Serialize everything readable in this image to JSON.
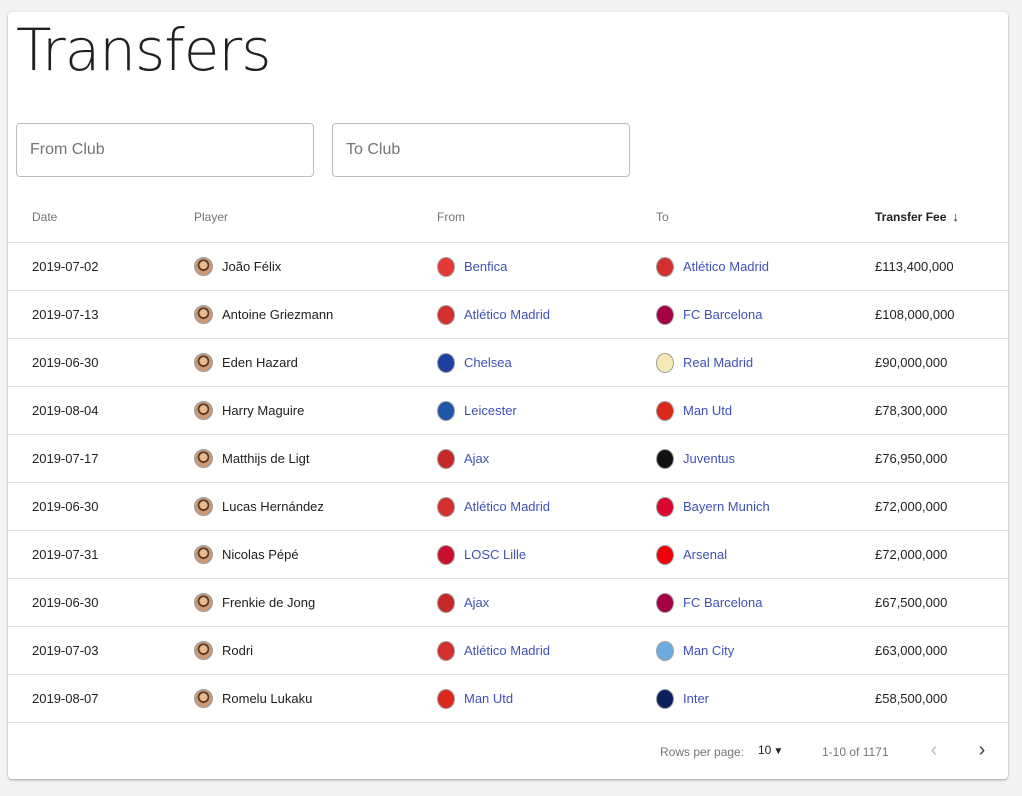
{
  "page": {
    "title": "Transfers"
  },
  "filters": {
    "from_placeholder": "From Club",
    "to_placeholder": "To Club"
  },
  "table": {
    "headers": {
      "date": "Date",
      "player": "Player",
      "from": "From",
      "to": "To",
      "fee": "Transfer Fee"
    },
    "sort_icon": "arrow-down-icon",
    "rows": [
      {
        "date": "2019-07-02",
        "player": "João Félix",
        "from": "Benfica",
        "to": "Atlético Madrid",
        "fee": "£113,400,000"
      },
      {
        "date": "2019-07-13",
        "player": "Antoine Griezmann",
        "from": "Atlético Madrid",
        "to": "FC Barcelona",
        "fee": "£108,000,000"
      },
      {
        "date": "2019-06-30",
        "player": "Eden Hazard",
        "from": "Chelsea",
        "to": "Real Madrid",
        "fee": "£90,000,000"
      },
      {
        "date": "2019-08-04",
        "player": "Harry Maguire",
        "from": "Leicester",
        "to": "Man Utd",
        "fee": "£78,300,000"
      },
      {
        "date": "2019-07-17",
        "player": "Matthijs de Ligt",
        "from": "Ajax",
        "to": "Juventus",
        "fee": "£76,950,000"
      },
      {
        "date": "2019-06-30",
        "player": "Lucas Hernández",
        "from": "Atlético Madrid",
        "to": "Bayern Munich",
        "fee": "£72,000,000"
      },
      {
        "date": "2019-07-31",
        "player": "Nicolas Pépé",
        "from": "LOSC Lille",
        "to": "Arsenal",
        "fee": "£72,000,000"
      },
      {
        "date": "2019-06-30",
        "player": "Frenkie de Jong",
        "from": "Ajax",
        "to": "FC Barcelona",
        "fee": "£67,500,000"
      },
      {
        "date": "2019-07-03",
        "player": "Rodri",
        "from": "Atlético Madrid",
        "to": "Man City",
        "fee": "£63,000,000"
      },
      {
        "date": "2019-08-07",
        "player": "Romelu Lukaku",
        "from": "Man Utd",
        "to": "Inter",
        "fee": "£58,500,000"
      }
    ]
  },
  "club_colors": {
    "Benfica": "#e53935",
    "Atlético Madrid": "#d32f2f",
    "FC Barcelona": "#a50044",
    "Chelsea": "#1e40a0",
    "Real Madrid": "#f5e9b8",
    "Leicester": "#1e56a8",
    "Man Utd": "#da291c",
    "Ajax": "#c62828",
    "Juventus": "#111111",
    "Bayern Munich": "#dc052d",
    "LOSC Lille": "#c8102e",
    "Arsenal": "#ef0107",
    "Man City": "#6cabdd",
    "Inter": "#0a1f5c"
  },
  "pagination": {
    "rows_per_page_label": "Rows per page:",
    "rows_per_page_value": "10",
    "range_text": "1-10 of 1171",
    "prev_icon": "chevron-left-icon",
    "next_icon": "chevron-right-icon"
  },
  "colors": {
    "link": "#3f51b5",
    "divider": "#e0e0e0"
  }
}
